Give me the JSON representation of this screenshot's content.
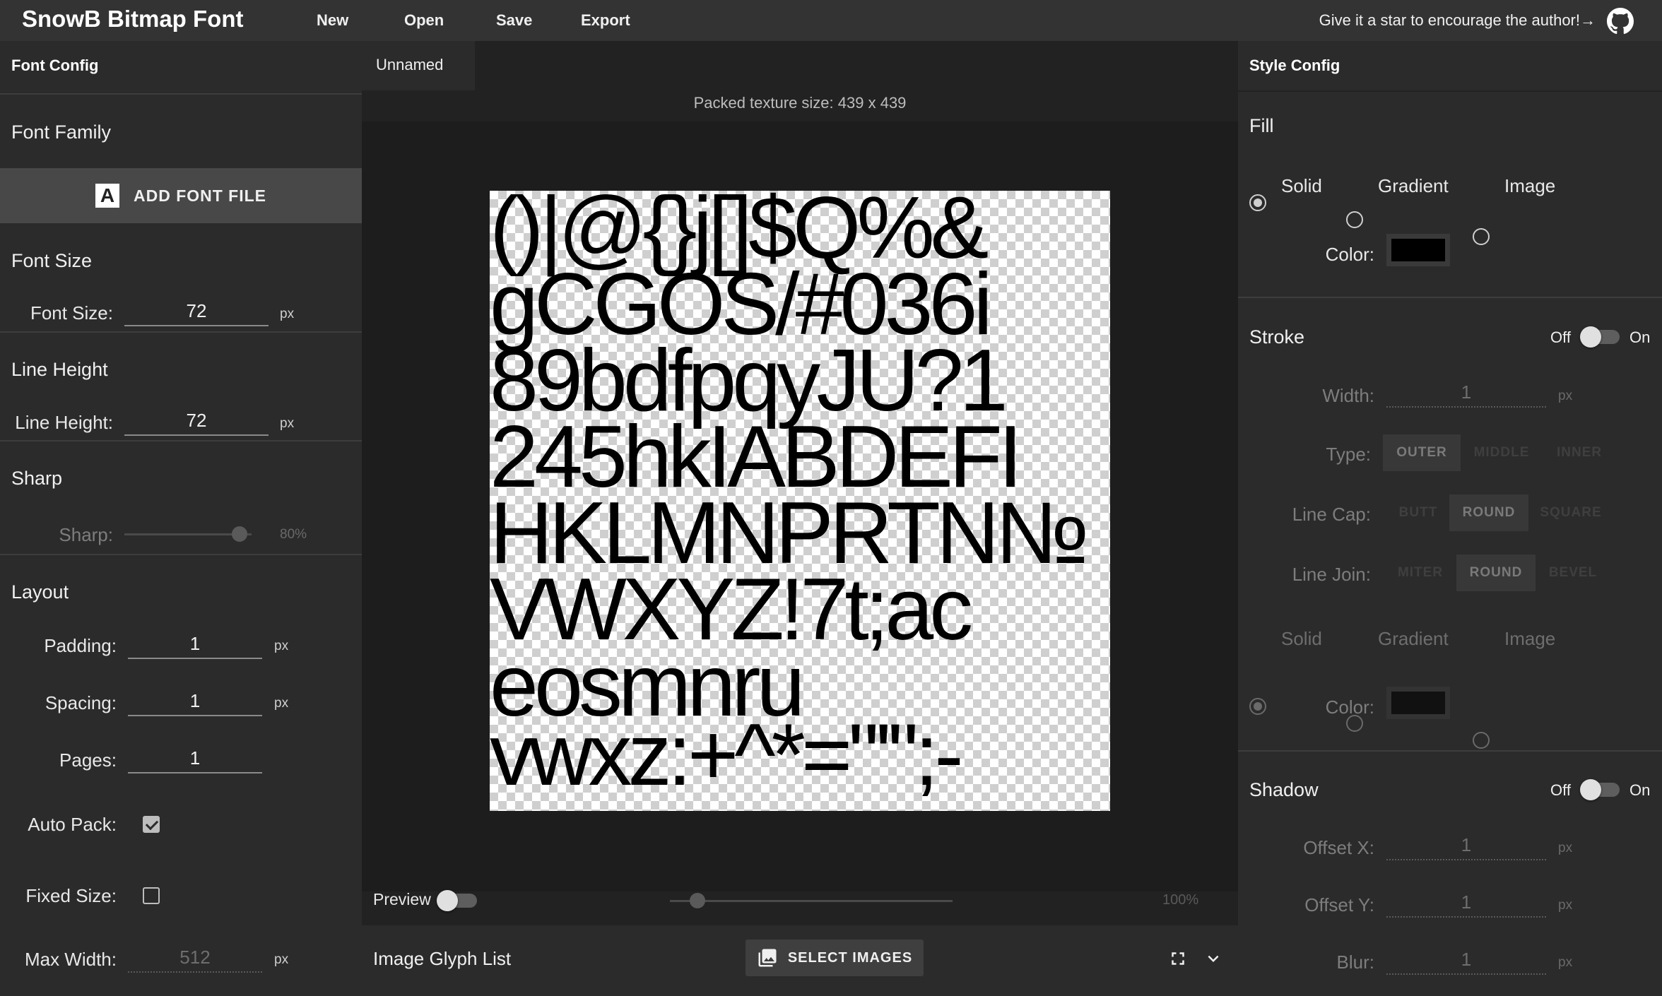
{
  "app": {
    "title": "SnowB Bitmap Font",
    "menu": [
      "New",
      "Open",
      "Save",
      "Export"
    ],
    "star_text": "Give it a star to encourage the author!→"
  },
  "left": {
    "header": "Font Config",
    "font_family": {
      "title": "Font Family",
      "button": "ADD FONT FILE",
      "button_icon": "font-letter-A-icon"
    },
    "font_size": {
      "title": "Font Size",
      "label": "Font Size:",
      "value": "72",
      "unit": "px"
    },
    "line_height": {
      "title": "Line Height",
      "label": "Line Height:",
      "value": "72",
      "unit": "px"
    },
    "sharp": {
      "title": "Sharp",
      "label": "Sharp:",
      "value": "80%",
      "level": 0.8
    },
    "layout": {
      "title": "Layout",
      "padding": {
        "label": "Padding:",
        "value": "1",
        "unit": "px"
      },
      "spacing": {
        "label": "Spacing:",
        "value": "1",
        "unit": "px"
      },
      "pages": {
        "label": "Pages:",
        "value": "1"
      },
      "auto_pack": {
        "label": "Auto Pack:",
        "checked": true
      },
      "fixed_size": {
        "label": "Fixed Size:",
        "checked": false
      },
      "max_width": {
        "label": "Max Width:",
        "value": "512",
        "unit": "px"
      }
    }
  },
  "center": {
    "tab": "Unnamed",
    "packed_text": "Packed texture size: 439 x 439",
    "glyph_rows": [
      "()|@{}j[]$Q%&",
      "gCGOS/#036i",
      "89bdfpqyJU?1",
      "245hkIABDEFI",
      "HKLMNPRTN№",
      "VWXYZ!7t;ac",
      "eosmnru",
      "vwxz:+^*=\"'\";-"
    ],
    "preview": {
      "label": "Preview",
      "on": false
    },
    "zoom": {
      "value": "100%",
      "level": 0.1
    },
    "glyph_list": {
      "title": "Image Glyph List",
      "button": "SELECT IMAGES"
    }
  },
  "right": {
    "header": "Style Config",
    "fill": {
      "title": "Fill",
      "options": [
        "Solid",
        "Gradient",
        "Image"
      ],
      "selected": "Solid",
      "color_label": "Color:",
      "color": "#000000"
    },
    "stroke": {
      "title": "Stroke",
      "off": "Off",
      "on": "On",
      "enabled": false,
      "width": {
        "label": "Width:",
        "value": "1",
        "unit": "px"
      },
      "type": {
        "label": "Type:",
        "options": [
          "OUTER",
          "MIDDLE",
          "INNER"
        ],
        "selected": "OUTER"
      },
      "line_cap": {
        "label": "Line Cap:",
        "options": [
          "BUTT",
          "ROUND",
          "SQUARE"
        ],
        "selected": "ROUND"
      },
      "line_join": {
        "label": "Line Join:",
        "options": [
          "MITER",
          "ROUND",
          "BEVEL"
        ],
        "selected": "ROUND"
      },
      "fill_options": [
        "Solid",
        "Gradient",
        "Image"
      ],
      "color_label": "Color:"
    },
    "shadow": {
      "title": "Shadow",
      "off": "Off",
      "on": "On",
      "enabled": false,
      "offset_x": {
        "label": "Offset X:",
        "value": "1",
        "unit": "px"
      },
      "offset_y": {
        "label": "Offset Y:",
        "value": "1",
        "unit": "px"
      },
      "blur": {
        "label": "Blur:",
        "value": "1",
        "unit": "px"
      }
    }
  }
}
